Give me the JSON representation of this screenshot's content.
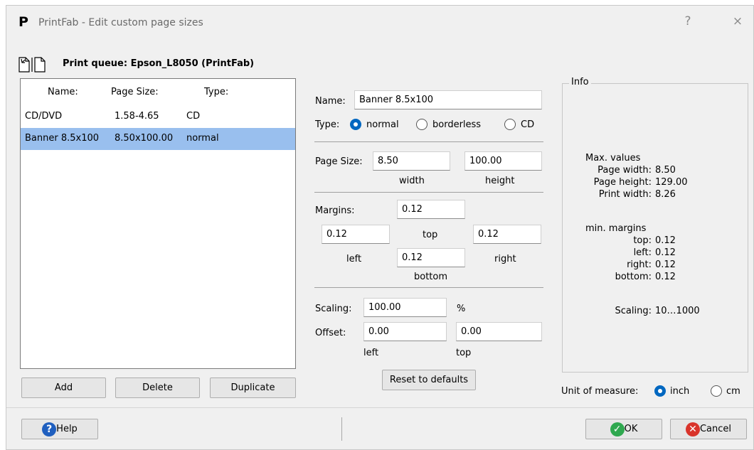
{
  "window": {
    "logo_letter": "P",
    "title": "PrintFab - Edit custom page sizes",
    "help_glyph": "?",
    "close_glyph": "×"
  },
  "queue": {
    "label": "Print queue: Epson_L8050 (PrintFab)"
  },
  "list": {
    "headers": {
      "name": "Name:",
      "size": "Page Size:",
      "type": "Type:"
    },
    "rows": [
      {
        "name": "CD/DVD",
        "size": "1.58-4.65",
        "type": "CD"
      },
      {
        "name": "Banner 8.5x100",
        "size": "8.50x100.00",
        "type": "normal"
      }
    ]
  },
  "list_buttons": {
    "add": "Add",
    "delete": "Delete",
    "duplicate": "Duplicate"
  },
  "form": {
    "name_label": "Name:",
    "name_value": "Banner 8.5x100",
    "type_label": "Type:",
    "type_options": [
      "normal",
      "borderless",
      "CD"
    ],
    "type_selected": "normal",
    "page_size_label": "Page Size:",
    "width_value": "8.50",
    "height_value": "100.00",
    "width_caption": "width",
    "height_caption": "height",
    "margins_label": "Margins:",
    "margin_top": "0.12",
    "margin_left": "0.12",
    "margin_right": "0.12",
    "margin_bottom": "0.12",
    "top_caption": "top",
    "left_caption": "left",
    "right_caption": "right",
    "bottom_caption": "bottom",
    "scaling_label": "Scaling:",
    "scaling_value": "100.00",
    "percent": "%",
    "offset_label": "Offset:",
    "offset_left": "0.00",
    "offset_top": "0.00",
    "offset_left_caption": "left",
    "offset_top_caption": "top",
    "reset_button": "Reset to defaults"
  },
  "info": {
    "title": "Info",
    "max_heading": "Max. values",
    "max": [
      {
        "label": "Page width:",
        "value": "8.50"
      },
      {
        "label": "Page height:",
        "value": "129.00"
      },
      {
        "label": "Print width:",
        "value": "8.26"
      }
    ],
    "min_heading": "min. margins",
    "min": [
      {
        "label": "top:",
        "value": "0.12"
      },
      {
        "label": "left:",
        "value": "0.12"
      },
      {
        "label": "right:",
        "value": "0.12"
      },
      {
        "label": "bottom:",
        "value": "0.12"
      }
    ],
    "scaling_label": "Scaling:",
    "scaling_range": "10…1000"
  },
  "unit": {
    "label": "Unit of measure:",
    "options": [
      "inch",
      "cm"
    ],
    "selected": "inch"
  },
  "footer": {
    "help": "Help",
    "ok": "OK",
    "cancel": "Cancel"
  },
  "colors": {
    "selection": "#99bfee",
    "radio_on": "#0067c0",
    "ok_icon": "#2fa84f",
    "cancel_icon": "#d9342b",
    "help_icon": "#1f5fbf"
  }
}
